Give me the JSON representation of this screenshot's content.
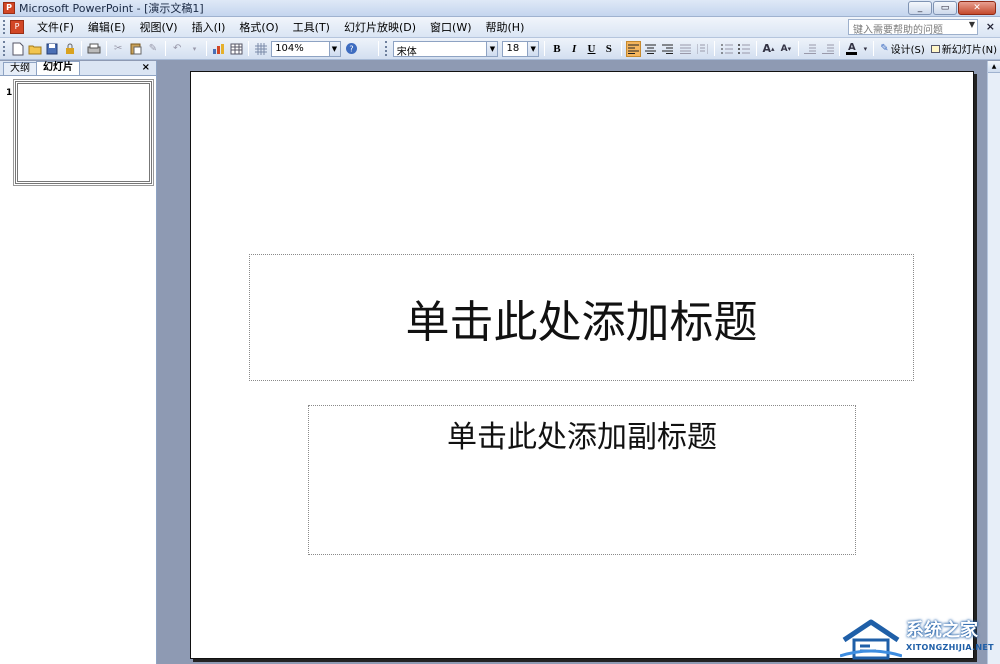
{
  "window": {
    "title": "Microsoft PowerPoint - [演示文稿1]",
    "minimize": "_",
    "restore": "▭",
    "close": "✕"
  },
  "menu": {
    "items": [
      "文件(F)",
      "编辑(E)",
      "视图(V)",
      "插入(I)",
      "格式(O)",
      "工具(T)",
      "幻灯片放映(D)",
      "窗口(W)",
      "帮助(H)"
    ],
    "help_placeholder": "键入需要帮助的问题",
    "doc_close": "×"
  },
  "toolbar": {
    "zoom": "104%",
    "font_name": "宋体",
    "font_size": "18",
    "bold": "B",
    "italic": "I",
    "underline": "U",
    "shadow": "S",
    "design_label": "设计(S)",
    "new_slide_label": "新幻灯片(N)"
  },
  "left_panel": {
    "tab_outline": "大纲",
    "tab_slides": "幻灯片",
    "close": "×",
    "slide_number": "1"
  },
  "slide": {
    "title_placeholder": "单击此处添加标题",
    "subtitle_placeholder": "单击此处添加副标题"
  },
  "watermark": {
    "cn": "系统之家",
    "en": "XITONGZHIJIA.NET"
  },
  "colors": {
    "accent_blue": "#1f5fa8",
    "active_align": "#f5b65e",
    "workspace": "#8e9ab3"
  }
}
